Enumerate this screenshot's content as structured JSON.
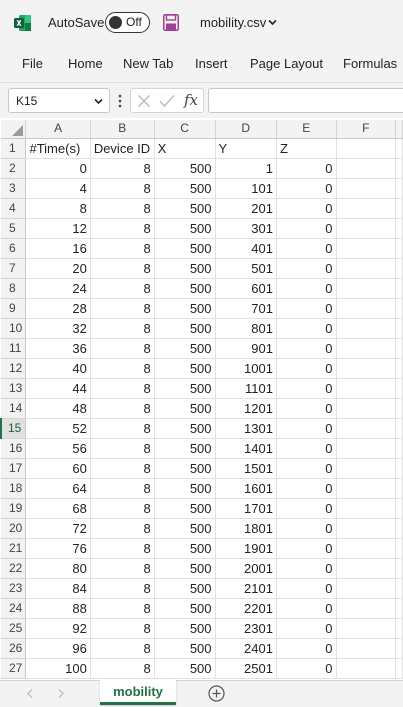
{
  "titlebar": {
    "autosave_label": "AutoSave",
    "autosave_state": "Off",
    "file_name": "mobility.csv"
  },
  "ribbon": {
    "tabs": [
      "File",
      "Home",
      "New Tab",
      "Insert",
      "Page Layout",
      "Formulas"
    ]
  },
  "formula_bar": {
    "name_box": "K15",
    "fx_label": "fx",
    "formula_value": ""
  },
  "grid": {
    "columns": [
      "A",
      "B",
      "C",
      "D",
      "E",
      "F"
    ],
    "active_row": 15,
    "rows": [
      {
        "n": "1",
        "cells": [
          "#Time(s)",
          "Device ID",
          "X",
          "Y",
          "Z",
          ""
        ]
      },
      {
        "n": "2",
        "cells": [
          "0",
          "8",
          "500",
          "1",
          "0",
          ""
        ]
      },
      {
        "n": "3",
        "cells": [
          "4",
          "8",
          "500",
          "101",
          "0",
          ""
        ]
      },
      {
        "n": "4",
        "cells": [
          "8",
          "8",
          "500",
          "201",
          "0",
          ""
        ]
      },
      {
        "n": "5",
        "cells": [
          "12",
          "8",
          "500",
          "301",
          "0",
          ""
        ]
      },
      {
        "n": "6",
        "cells": [
          "16",
          "8",
          "500",
          "401",
          "0",
          ""
        ]
      },
      {
        "n": "7",
        "cells": [
          "20",
          "8",
          "500",
          "501",
          "0",
          ""
        ]
      },
      {
        "n": "8",
        "cells": [
          "24",
          "8",
          "500",
          "601",
          "0",
          ""
        ]
      },
      {
        "n": "9",
        "cells": [
          "28",
          "8",
          "500",
          "701",
          "0",
          ""
        ]
      },
      {
        "n": "10",
        "cells": [
          "32",
          "8",
          "500",
          "801",
          "0",
          ""
        ]
      },
      {
        "n": "11",
        "cells": [
          "36",
          "8",
          "500",
          "901",
          "0",
          ""
        ]
      },
      {
        "n": "12",
        "cells": [
          "40",
          "8",
          "500",
          "1001",
          "0",
          ""
        ]
      },
      {
        "n": "13",
        "cells": [
          "44",
          "8",
          "500",
          "1101",
          "0",
          ""
        ]
      },
      {
        "n": "14",
        "cells": [
          "48",
          "8",
          "500",
          "1201",
          "0",
          ""
        ]
      },
      {
        "n": "15",
        "cells": [
          "52",
          "8",
          "500",
          "1301",
          "0",
          ""
        ]
      },
      {
        "n": "16",
        "cells": [
          "56",
          "8",
          "500",
          "1401",
          "0",
          ""
        ]
      },
      {
        "n": "17",
        "cells": [
          "60",
          "8",
          "500",
          "1501",
          "0",
          ""
        ]
      },
      {
        "n": "18",
        "cells": [
          "64",
          "8",
          "500",
          "1601",
          "0",
          ""
        ]
      },
      {
        "n": "19",
        "cells": [
          "68",
          "8",
          "500",
          "1701",
          "0",
          ""
        ]
      },
      {
        "n": "20",
        "cells": [
          "72",
          "8",
          "500",
          "1801",
          "0",
          ""
        ]
      },
      {
        "n": "21",
        "cells": [
          "76",
          "8",
          "500",
          "1901",
          "0",
          ""
        ]
      },
      {
        "n": "22",
        "cells": [
          "80",
          "8",
          "500",
          "2001",
          "0",
          ""
        ]
      },
      {
        "n": "23",
        "cells": [
          "84",
          "8",
          "500",
          "2101",
          "0",
          ""
        ]
      },
      {
        "n": "24",
        "cells": [
          "88",
          "8",
          "500",
          "2201",
          "0",
          ""
        ]
      },
      {
        "n": "25",
        "cells": [
          "92",
          "8",
          "500",
          "2301",
          "0",
          ""
        ]
      },
      {
        "n": "26",
        "cells": [
          "96",
          "8",
          "500",
          "2401",
          "0",
          ""
        ]
      },
      {
        "n": "27",
        "cells": [
          "100",
          "8",
          "500",
          "2501",
          "0",
          ""
        ]
      }
    ]
  },
  "sheets": {
    "tabs": [
      "mobility"
    ],
    "active": "mobility"
  },
  "colors": {
    "excel_green": "#217346",
    "save_purple": "#a33e96"
  },
  "icons": [
    "excel-logo-icon",
    "save-icon",
    "chevron-down-icon",
    "more-options-icon",
    "cancel-icon",
    "enter-check-icon",
    "select-all-icon",
    "scroll-left-icon",
    "scroll-right-icon",
    "add-sheet-icon"
  ]
}
